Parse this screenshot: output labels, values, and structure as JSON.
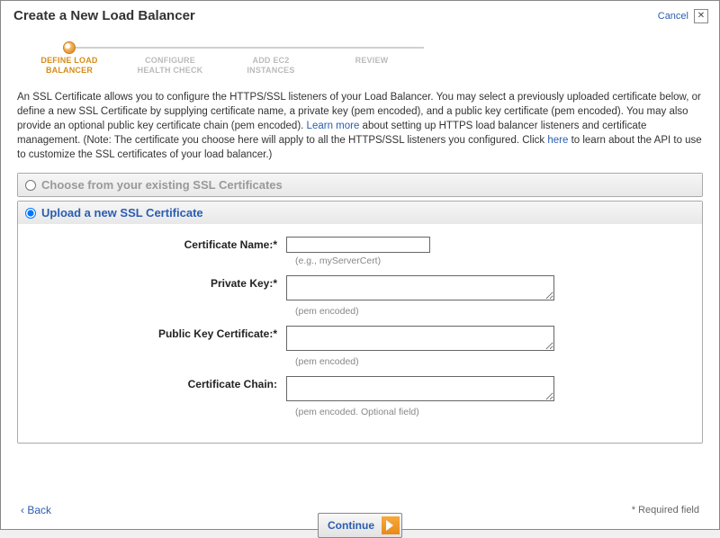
{
  "dialog": {
    "title": "Create a New Load Balancer",
    "cancel": "Cancel"
  },
  "wizard": {
    "steps": [
      {
        "label_line1": "DEFINE LOAD",
        "label_line2": "BALANCER"
      },
      {
        "label_line1": "CONFIGURE",
        "label_line2": "HEALTH CHECK"
      },
      {
        "label_line1": "ADD EC2",
        "label_line2": "INSTANCES"
      },
      {
        "label_line1": "REVIEW",
        "label_line2": ""
      }
    ]
  },
  "description": {
    "text1": "An SSL Certificate allows you to configure the HTTPS/SSL listeners of your Load Balancer. You may select a previously uploaded certificate below, or define a new SSL Certificate by supplying certificate name, a private key (pem encoded), and a public key certificate (pem encoded). You may also provide an optional public key certificate chain (pem encoded). ",
    "link1": "Learn more",
    "text2": " about setting up HTTPS load balancer listeners and certificate management. (Note: The certificate you choose here will apply to all the HTTPS/SSL listeners you configured. Click ",
    "link2": "here",
    "text3": " to learn about the API to use to customize the SSL certificates of your load balancer.)"
  },
  "panels": {
    "existing": {
      "label": "Choose from your existing SSL Certificates"
    },
    "upload": {
      "label": "Upload a new SSL Certificate"
    }
  },
  "form": {
    "cert_name": {
      "label": "Certificate Name:*",
      "hint": "(e.g., myServerCert)",
      "value": ""
    },
    "private_key": {
      "label": "Private Key:*",
      "hint": "(pem encoded)",
      "value": ""
    },
    "public_cert": {
      "label": "Public Key Certificate:*",
      "hint": "(pem encoded)",
      "value": ""
    },
    "cert_chain": {
      "label": "Certificate Chain:",
      "hint": "(pem encoded. Optional field)",
      "value": ""
    }
  },
  "footer": {
    "back": "Back",
    "continue": "Continue",
    "required": "* Required field"
  }
}
